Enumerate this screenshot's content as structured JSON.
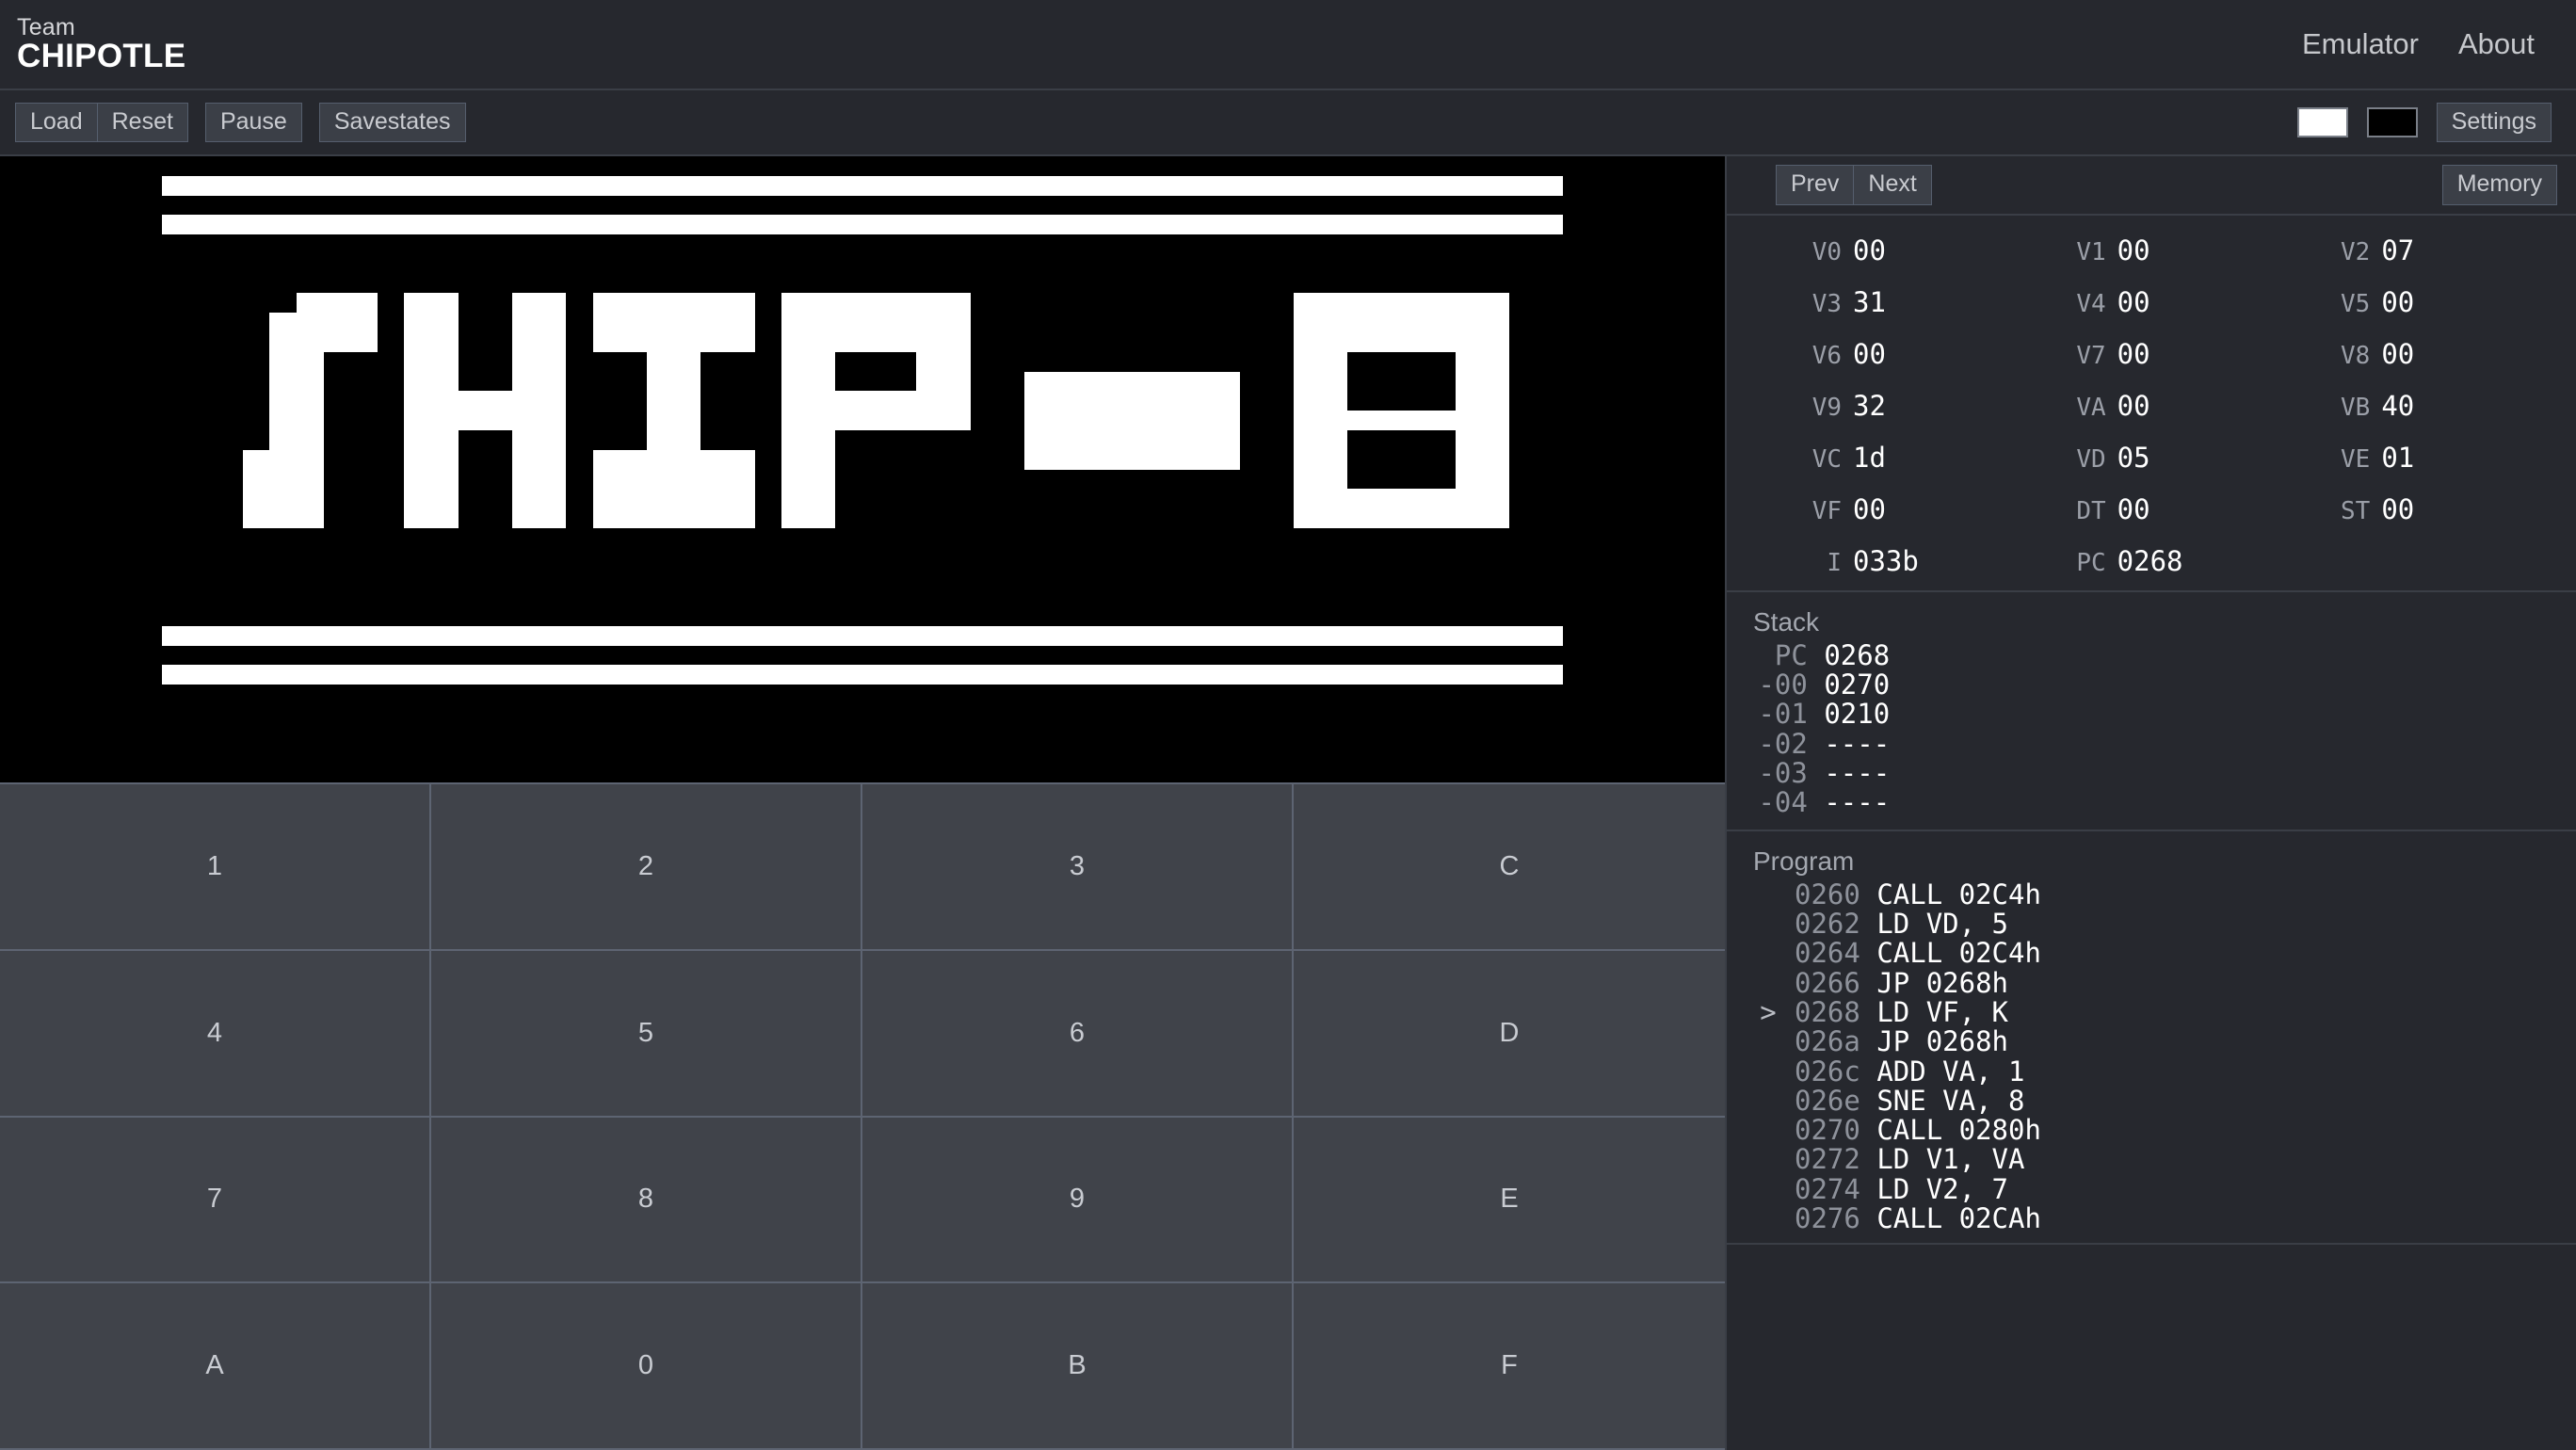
{
  "header": {
    "brand_top": "Team",
    "brand_bottom": "CHIPOTLE",
    "nav": [
      {
        "label": "Emulator",
        "name": "nav-link-emulator"
      },
      {
        "label": "About",
        "name": "nav-link-about"
      }
    ]
  },
  "toolbar": {
    "load_label": "Load",
    "reset_label": "Reset",
    "pause_label": "Pause",
    "savestates_label": "Savestates",
    "settings_label": "Settings",
    "fg_color": "#ffffff",
    "bg_color": "#000000"
  },
  "screen": {
    "background": "#000000",
    "foreground": "#ffffff",
    "rom": "CHIP-8 logo"
  },
  "keypad": {
    "keys": [
      "1",
      "2",
      "3",
      "C",
      "4",
      "5",
      "6",
      "D",
      "7",
      "8",
      "9",
      "E",
      "A",
      "0",
      "B",
      "F"
    ]
  },
  "debugger": {
    "prev_label": "Prev",
    "next_label": "Next",
    "memory_label": "Memory",
    "registers": [
      {
        "name": "V0",
        "value": "00"
      },
      {
        "name": "V1",
        "value": "00"
      },
      {
        "name": "V2",
        "value": "07"
      },
      {
        "name": "V3",
        "value": "31"
      },
      {
        "name": "V4",
        "value": "00"
      },
      {
        "name": "V5",
        "value": "00"
      },
      {
        "name": "V6",
        "value": "00"
      },
      {
        "name": "V7",
        "value": "00"
      },
      {
        "name": "V8",
        "value": "00"
      },
      {
        "name": "V9",
        "value": "32"
      },
      {
        "name": "VA",
        "value": "00"
      },
      {
        "name": "VB",
        "value": "40"
      },
      {
        "name": "VC",
        "value": "1d"
      },
      {
        "name": "VD",
        "value": "05"
      },
      {
        "name": "VE",
        "value": "01"
      },
      {
        "name": "VF",
        "value": "00"
      },
      {
        "name": "DT",
        "value": "00"
      },
      {
        "name": "ST",
        "value": "00"
      },
      {
        "name": "I",
        "value": "033b"
      },
      {
        "name": "PC",
        "value": "0268"
      }
    ],
    "stack": {
      "title": "Stack",
      "rows": [
        {
          "label": "  PC",
          "value": "0268"
        },
        {
          "label": " -00",
          "value": "0270"
        },
        {
          "label": " -01",
          "value": "0210"
        },
        {
          "label": " -02",
          "value": "----"
        },
        {
          "label": " -03",
          "value": "----"
        },
        {
          "label": " -04",
          "value": "----"
        }
      ]
    },
    "program": {
      "title": "Program",
      "rows": [
        {
          "marker": "",
          "addr": "0260",
          "text": "CALL 02C4h"
        },
        {
          "marker": "",
          "addr": "0262",
          "text": "LD VD, 5"
        },
        {
          "marker": "",
          "addr": "0264",
          "text": "CALL 02C4h"
        },
        {
          "marker": "",
          "addr": "0266",
          "text": "JP 0268h"
        },
        {
          "marker": ">",
          "addr": "0268",
          "text": "LD VF, K"
        },
        {
          "marker": "",
          "addr": "026a",
          "text": "JP 0268h"
        },
        {
          "marker": "",
          "addr": "026c",
          "text": "ADD VA, 1"
        },
        {
          "marker": "",
          "addr": "026e",
          "text": "SNE VA, 8"
        },
        {
          "marker": "",
          "addr": "0270",
          "text": "CALL 0280h"
        },
        {
          "marker": "",
          "addr": "0272",
          "text": "LD V1, VA"
        },
        {
          "marker": "",
          "addr": "0274",
          "text": "LD V2, 7"
        },
        {
          "marker": "",
          "addr": "0276",
          "text": "CALL 02CAh"
        }
      ]
    }
  }
}
